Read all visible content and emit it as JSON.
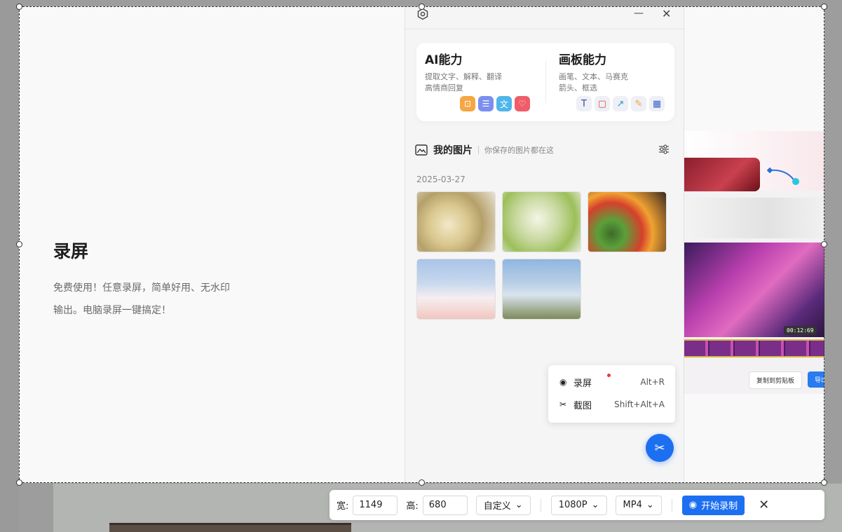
{
  "hero": {
    "title": "录屏",
    "desc_line1": "免费使用！任意录屏，简单好用、无水印",
    "desc_line2": "输出。电脑录屏一键搞定！"
  },
  "titlebar": {
    "settings_icon": "hexagon-gear-icon",
    "minimize_glyph": "—",
    "close_glyph": "✕"
  },
  "ai_card": {
    "ai_title": "AI能力",
    "ai_sub1": "提取文字、解释、翻译",
    "ai_sub2": "高情商回复",
    "board_title": "画板能力",
    "board_sub1": "画笔、文本、马赛克",
    "board_sub2": "箭头、框选",
    "ai_icons": [
      {
        "name": "ocr-icon",
        "glyph": "⊡",
        "color": "#f5a742"
      },
      {
        "name": "explain-icon",
        "glyph": "☰",
        "color": "#7a8ff0"
      },
      {
        "name": "translate-icon",
        "glyph": "文",
        "color": "#4fb6ea"
      },
      {
        "name": "reply-icon",
        "glyph": "♡",
        "color": "#ef5d6a"
      }
    ],
    "tool_icons": [
      {
        "name": "text-tool-icon",
        "glyph": "T",
        "color": "#3b4a9a"
      },
      {
        "name": "rect-tool-icon",
        "glyph": "▢",
        "color": "#e2453c"
      },
      {
        "name": "arrow-tool-icon",
        "glyph": "↗",
        "color": "#2d8fd6"
      },
      {
        "name": "pen-tool-icon",
        "glyph": "✎",
        "color": "#f2a23a"
      },
      {
        "name": "mosaic-tool-icon",
        "glyph": "▦",
        "color": "#3a63c9"
      }
    ]
  },
  "gallery": {
    "title": "我的图片",
    "subtitle": "你保存的图片都在这",
    "date": "2025-03-27"
  },
  "popup": {
    "record_label": "录屏",
    "record_shortcut": "Alt+R",
    "screenshot_label": "截图",
    "screenshot_shortcut": "Shift+Alt+A"
  },
  "preview": {
    "timestamp": "00:12:69",
    "copy_label": "复制到剪贴板",
    "export_label": "导出"
  },
  "toolbar": {
    "width_label": "宽:",
    "width_value": "1149",
    "height_label": "高:",
    "height_value": "680",
    "ratio": "自定义",
    "resolution": "1080P",
    "format": "MP4",
    "record_button": "开始录制"
  },
  "colors": {
    "accent": "#1d6ff2"
  }
}
